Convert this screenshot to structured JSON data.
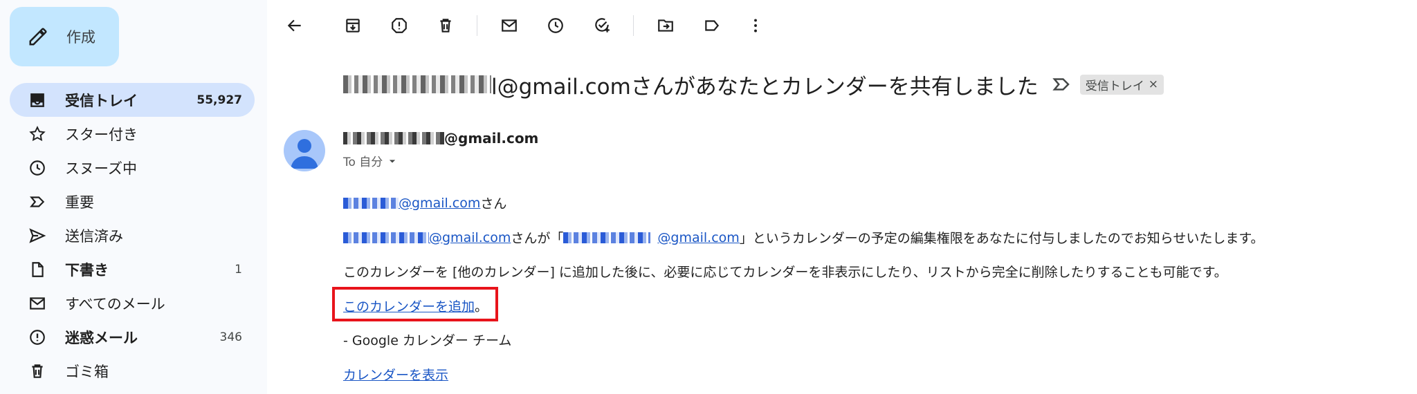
{
  "sidebar": {
    "compose_label": "作成",
    "items": [
      {
        "label": "受信トレイ",
        "count": "55,927",
        "icon": "inbox-icon",
        "bold": true,
        "active": true
      },
      {
        "label": "スター付き",
        "count": "",
        "icon": "star-icon",
        "bold": false,
        "active": false
      },
      {
        "label": "スヌーズ中",
        "count": "",
        "icon": "clock-icon",
        "bold": false,
        "active": false
      },
      {
        "label": "重要",
        "count": "",
        "icon": "important-icon",
        "bold": false,
        "active": false
      },
      {
        "label": "送信済み",
        "count": "",
        "icon": "send-icon",
        "bold": false,
        "active": false
      },
      {
        "label": "下書き",
        "count": "1",
        "icon": "draft-icon",
        "bold": true,
        "active": false
      },
      {
        "label": "すべてのメール",
        "count": "",
        "icon": "mail-icon",
        "bold": false,
        "active": false
      },
      {
        "label": "迷惑メール",
        "count": "346",
        "icon": "spam-icon",
        "bold": true,
        "active": false
      },
      {
        "label": "ゴミ箱",
        "count": "",
        "icon": "trash-icon",
        "bold": false,
        "active": false
      }
    ]
  },
  "email": {
    "subject_suffix": "l@gmail.comさんがあなたとカレンダーを共有しました",
    "label_chip": "受信トレイ",
    "label_chip_close": "×",
    "sender_domain": "@gmail.com",
    "to_text": "To 自分",
    "greeting_link": "@gmail.com",
    "greeting_suffix": " さん",
    "line2_link1": "@gmail.com",
    "line2_text1": " さんが「",
    "line2_link2": "@gmail.com",
    "line2_text2": "」というカレンダーの予定の編集権限をあなたに付与しましたのでお知らせいたします。",
    "line3": "このカレンダーを [他のカレンダー] に追加した後に、必要に応じてカレンダーを非表示にしたり、リストから完全に削除したりすることも可能です。",
    "add_link": "このカレンダーを追加",
    "add_suffix": "。",
    "signature": "- Google カレンダー チーム",
    "view_link": "カレンダーを表示"
  },
  "colors": {
    "sidebar_bg": "#f8fafd",
    "compose_bg": "#c2e7ff",
    "active_bg": "#d3e3fd",
    "link": "#1a56c5",
    "highlight": "#e8141b"
  }
}
